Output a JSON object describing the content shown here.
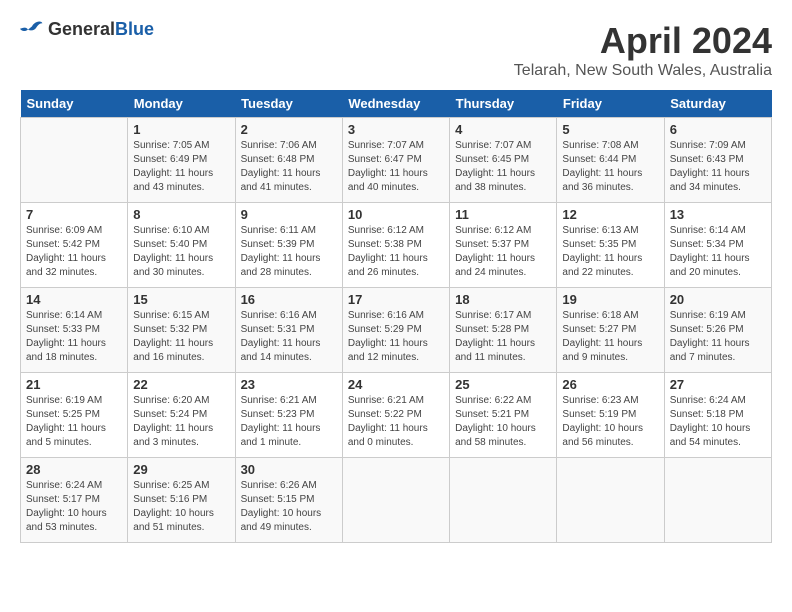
{
  "header": {
    "logo_line1": "General",
    "logo_line2": "Blue",
    "month_year": "April 2024",
    "location": "Telarah, New South Wales, Australia"
  },
  "weekdays": [
    "Sunday",
    "Monday",
    "Tuesday",
    "Wednesday",
    "Thursday",
    "Friday",
    "Saturday"
  ],
  "weeks": [
    [
      {
        "day": "",
        "info": ""
      },
      {
        "day": "1",
        "info": "Sunrise: 7:05 AM\nSunset: 6:49 PM\nDaylight: 11 hours\nand 43 minutes."
      },
      {
        "day": "2",
        "info": "Sunrise: 7:06 AM\nSunset: 6:48 PM\nDaylight: 11 hours\nand 41 minutes."
      },
      {
        "day": "3",
        "info": "Sunrise: 7:07 AM\nSunset: 6:47 PM\nDaylight: 11 hours\nand 40 minutes."
      },
      {
        "day": "4",
        "info": "Sunrise: 7:07 AM\nSunset: 6:45 PM\nDaylight: 11 hours\nand 38 minutes."
      },
      {
        "day": "5",
        "info": "Sunrise: 7:08 AM\nSunset: 6:44 PM\nDaylight: 11 hours\nand 36 minutes."
      },
      {
        "day": "6",
        "info": "Sunrise: 7:09 AM\nSunset: 6:43 PM\nDaylight: 11 hours\nand 34 minutes."
      }
    ],
    [
      {
        "day": "7",
        "info": "Sunrise: 6:09 AM\nSunset: 5:42 PM\nDaylight: 11 hours\nand 32 minutes."
      },
      {
        "day": "8",
        "info": "Sunrise: 6:10 AM\nSunset: 5:40 PM\nDaylight: 11 hours\nand 30 minutes."
      },
      {
        "day": "9",
        "info": "Sunrise: 6:11 AM\nSunset: 5:39 PM\nDaylight: 11 hours\nand 28 minutes."
      },
      {
        "day": "10",
        "info": "Sunrise: 6:12 AM\nSunset: 5:38 PM\nDaylight: 11 hours\nand 26 minutes."
      },
      {
        "day": "11",
        "info": "Sunrise: 6:12 AM\nSunset: 5:37 PM\nDaylight: 11 hours\nand 24 minutes."
      },
      {
        "day": "12",
        "info": "Sunrise: 6:13 AM\nSunset: 5:35 PM\nDaylight: 11 hours\nand 22 minutes."
      },
      {
        "day": "13",
        "info": "Sunrise: 6:14 AM\nSunset: 5:34 PM\nDaylight: 11 hours\nand 20 minutes."
      }
    ],
    [
      {
        "day": "14",
        "info": "Sunrise: 6:14 AM\nSunset: 5:33 PM\nDaylight: 11 hours\nand 18 minutes."
      },
      {
        "day": "15",
        "info": "Sunrise: 6:15 AM\nSunset: 5:32 PM\nDaylight: 11 hours\nand 16 minutes."
      },
      {
        "day": "16",
        "info": "Sunrise: 6:16 AM\nSunset: 5:31 PM\nDaylight: 11 hours\nand 14 minutes."
      },
      {
        "day": "17",
        "info": "Sunrise: 6:16 AM\nSunset: 5:29 PM\nDaylight: 11 hours\nand 12 minutes."
      },
      {
        "day": "18",
        "info": "Sunrise: 6:17 AM\nSunset: 5:28 PM\nDaylight: 11 hours\nand 11 minutes."
      },
      {
        "day": "19",
        "info": "Sunrise: 6:18 AM\nSunset: 5:27 PM\nDaylight: 11 hours\nand 9 minutes."
      },
      {
        "day": "20",
        "info": "Sunrise: 6:19 AM\nSunset: 5:26 PM\nDaylight: 11 hours\nand 7 minutes."
      }
    ],
    [
      {
        "day": "21",
        "info": "Sunrise: 6:19 AM\nSunset: 5:25 PM\nDaylight: 11 hours\nand 5 minutes."
      },
      {
        "day": "22",
        "info": "Sunrise: 6:20 AM\nSunset: 5:24 PM\nDaylight: 11 hours\nand 3 minutes."
      },
      {
        "day": "23",
        "info": "Sunrise: 6:21 AM\nSunset: 5:23 PM\nDaylight: 11 hours\nand 1 minute."
      },
      {
        "day": "24",
        "info": "Sunrise: 6:21 AM\nSunset: 5:22 PM\nDaylight: 11 hours\nand 0 minutes."
      },
      {
        "day": "25",
        "info": "Sunrise: 6:22 AM\nSunset: 5:21 PM\nDaylight: 10 hours\nand 58 minutes."
      },
      {
        "day": "26",
        "info": "Sunrise: 6:23 AM\nSunset: 5:19 PM\nDaylight: 10 hours\nand 56 minutes."
      },
      {
        "day": "27",
        "info": "Sunrise: 6:24 AM\nSunset: 5:18 PM\nDaylight: 10 hours\nand 54 minutes."
      }
    ],
    [
      {
        "day": "28",
        "info": "Sunrise: 6:24 AM\nSunset: 5:17 PM\nDaylight: 10 hours\nand 53 minutes."
      },
      {
        "day": "29",
        "info": "Sunrise: 6:25 AM\nSunset: 5:16 PM\nDaylight: 10 hours\nand 51 minutes."
      },
      {
        "day": "30",
        "info": "Sunrise: 6:26 AM\nSunset: 5:15 PM\nDaylight: 10 hours\nand 49 minutes."
      },
      {
        "day": "",
        "info": ""
      },
      {
        "day": "",
        "info": ""
      },
      {
        "day": "",
        "info": ""
      },
      {
        "day": "",
        "info": ""
      }
    ]
  ]
}
